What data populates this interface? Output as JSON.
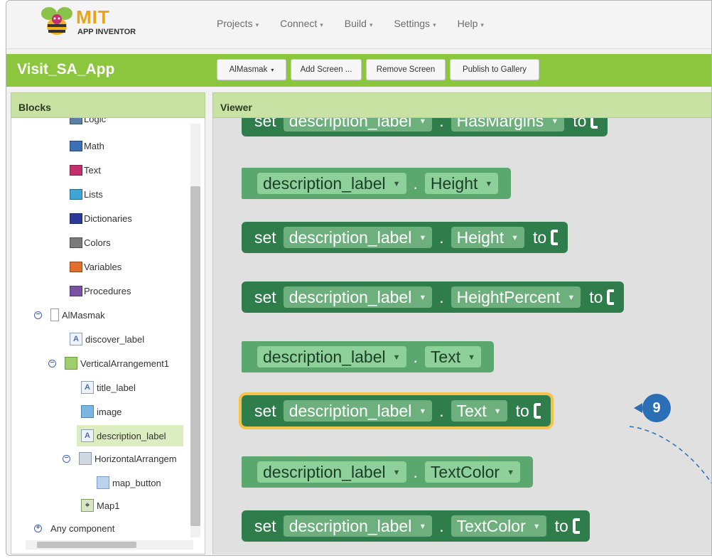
{
  "brand": {
    "name": "MIT",
    "sub": "APP INVENTOR"
  },
  "nav": [
    "Projects",
    "Connect",
    "Build",
    "Settings",
    "Help"
  ],
  "project": {
    "name": "Visit_SA_App",
    "screen_button": "AlMasmak",
    "add_screen": "Add Screen ...",
    "remove_screen": "Remove Screen",
    "publish": "Publish to Gallery"
  },
  "blocks_panel": {
    "title": "Blocks",
    "builtin": [
      {
        "label": "Logic",
        "color": "#5b80a5"
      },
      {
        "label": "Math",
        "color": "#3d6fb5"
      },
      {
        "label": "Text",
        "color": "#c2316b"
      },
      {
        "label": "Lists",
        "color": "#3da6d6"
      },
      {
        "label": "Dictionaries",
        "color": "#2d3a99"
      },
      {
        "label": "Colors",
        "color": "#7a7a7a"
      },
      {
        "label": "Variables",
        "color": "#e06f2b"
      },
      {
        "label": "Procedures",
        "color": "#7a52a3"
      }
    ],
    "screen": "AlMasmak",
    "components": {
      "discover_label": "discover_label",
      "vertical": "VerticalArrangement1",
      "title_label": "title_label",
      "image": "image",
      "description_label": "description_label",
      "horizontal": "HorizontalArrangem",
      "map_button": "map_button",
      "map": "Map1"
    },
    "any_component": "Any component"
  },
  "viewer": {
    "title": "Viewer",
    "blocks": [
      {
        "kind": "set",
        "keyword": "set",
        "component": "description_label",
        "property": "HasMargins",
        "to": "to"
      },
      {
        "kind": "get",
        "component": "description_label",
        "property": "Height"
      },
      {
        "kind": "set",
        "keyword": "set",
        "component": "description_label",
        "property": "Height",
        "to": "to"
      },
      {
        "kind": "set",
        "keyword": "set",
        "component": "description_label",
        "property": "HeightPercent",
        "to": "to"
      },
      {
        "kind": "get",
        "component": "description_label",
        "property": "Text"
      },
      {
        "kind": "set",
        "keyword": "set",
        "component": "description_label",
        "property": "Text",
        "to": "to"
      },
      {
        "kind": "get",
        "component": "description_label",
        "property": "TextColor"
      },
      {
        "kind": "set",
        "keyword": "set",
        "component": "description_label",
        "property": "TextColor",
        "to": "to"
      }
    ],
    "step_badge": "9"
  }
}
